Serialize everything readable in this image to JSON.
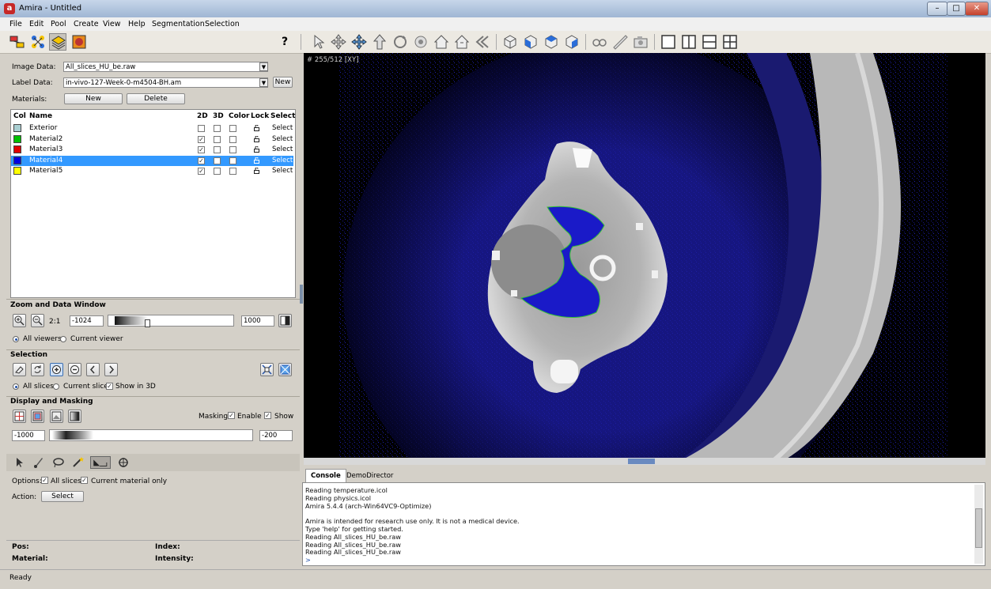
{
  "window": {
    "title": "Amira - Untitled",
    "app_icon_letter": "a",
    "minimize": "–",
    "maximize": "□",
    "close": "✕"
  },
  "menu": [
    "File",
    "Edit",
    "Pool",
    "Create",
    "View",
    "Help",
    "Segmentation",
    "Selection"
  ],
  "toolbar": {
    "help_label": "?"
  },
  "segmentation": {
    "image_data_label": "Image Data:",
    "image_data_value": "All_slices_HU_be.raw",
    "label_data_label": "Label Data:",
    "label_data_value": "in-vivo-127-Week-0-m4504-BH.am",
    "new_label_button": "New",
    "materials_label": "Materials:",
    "new_material_button": "New",
    "delete_material_button": "Delete"
  },
  "materials_table": {
    "headers": [
      "Col",
      "Name",
      "2D",
      "3D",
      "Color",
      "Lock",
      "Select"
    ],
    "rows": [
      {
        "color": "#a9cfd2",
        "name": "Exterior",
        "d2": false,
        "d3": false,
        "col": false,
        "select": "Select",
        "selected": false
      },
      {
        "color": "#00c000",
        "name": "Material2",
        "d2": true,
        "d3": false,
        "col": false,
        "select": "Select",
        "selected": false
      },
      {
        "color": "#e00000",
        "name": "Material3",
        "d2": true,
        "d3": false,
        "col": false,
        "select": "Select",
        "selected": false
      },
      {
        "color": "#0000e0",
        "name": "Material4",
        "d2": true,
        "d3": false,
        "col": false,
        "select": "Select",
        "selected": true
      },
      {
        "color": "#ffff00",
        "name": "Material5",
        "d2": true,
        "d3": false,
        "col": false,
        "select": "Select",
        "selected": false
      }
    ]
  },
  "zoom": {
    "title": "Zoom and Data Window",
    "ratio": "2:1",
    "min_value": "-1024",
    "max_value": "1000",
    "all_viewers": "All viewers",
    "current_viewer": "Current viewer"
  },
  "selection": {
    "title": "Selection",
    "all_slices": "All slices",
    "current_slice": "Current slice",
    "show_in_3d": "Show in 3D"
  },
  "display": {
    "title": "Display and Masking",
    "masking_label": "Masking:",
    "enable_label": "Enable",
    "show_label": "Show",
    "min_value": "-1000",
    "max_value": "-200"
  },
  "tool": {
    "options_label": "Options:",
    "all_slices": "All slices",
    "current_material_only": "Current material only",
    "action_label": "Action:",
    "action_button": "Select"
  },
  "info": {
    "pos_label": "Pos:",
    "index_label": "Index:",
    "material_label": "Material:",
    "intensity_label": "Intensity:"
  },
  "viewer": {
    "slice_label": "# 255/512 [XY]"
  },
  "console": {
    "tabs": [
      "Console",
      "DemoDirector"
    ],
    "lines": [
      "Reading temperature.icol",
      "Reading physics.icol",
      "Amira 5.4.4 (arch-Win64VC9-Optimize)",
      "",
      "Amira is intended for research use only. It is not a medical device.",
      "Type 'help' for getting started.",
      "Reading All_slices_HU_be.raw",
      "Reading All_slices_HU_be.raw",
      "Reading All_slices_HU_be.raw"
    ],
    "prompt": ">"
  },
  "status": {
    "text": "Ready"
  },
  "colors": {
    "selection_blue": "#3399ff",
    "mask_blue": "#1a1aa8"
  }
}
